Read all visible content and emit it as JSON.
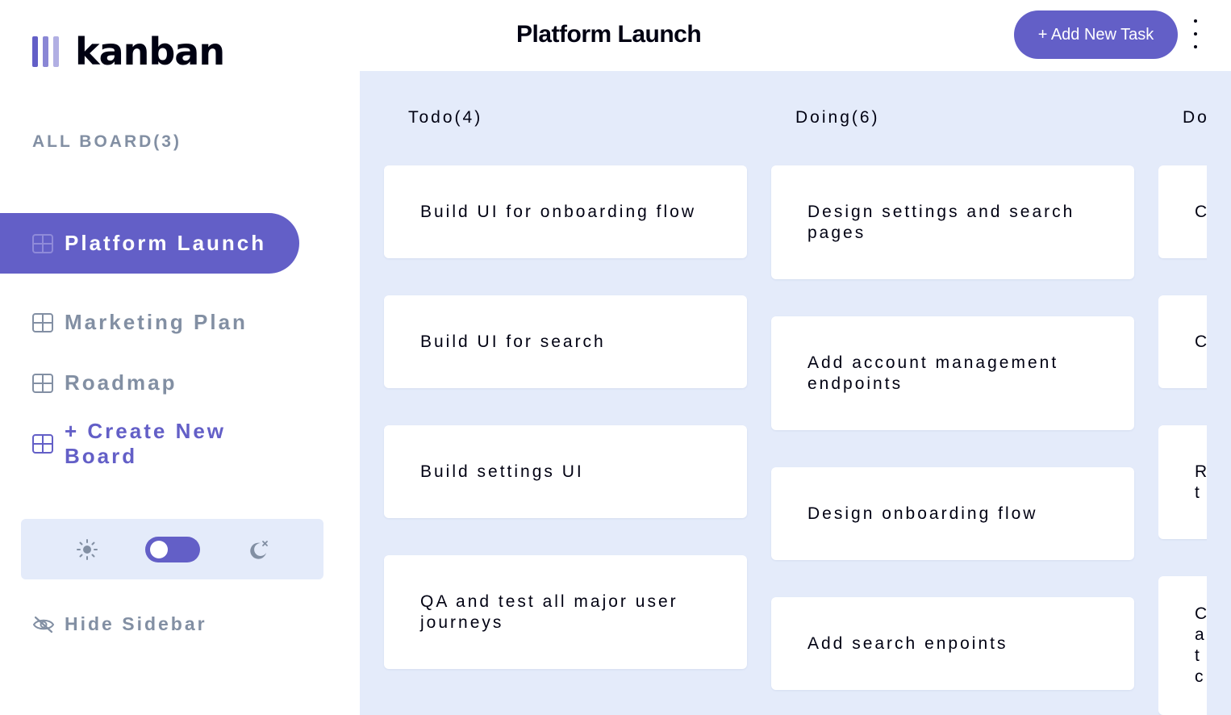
{
  "app": {
    "logo_text": "kanban"
  },
  "sidebar": {
    "board_count_label": "ALL BOARD(3)",
    "boards": [
      {
        "label": "Platform Launch",
        "active": true
      },
      {
        "label": "Marketing Plan",
        "active": false
      },
      {
        "label": "Roadmap",
        "active": false
      }
    ],
    "create_label": "+ Create New Board",
    "hide_label": "Hide Sidebar",
    "theme": {
      "light_icon": "sun-icon",
      "dark_icon": "moon-icon",
      "dark_mode": false
    }
  },
  "header": {
    "title": "Platform Launch",
    "add_task_label": "+ Add New Task"
  },
  "columns": [
    {
      "title": "Todo(4)",
      "tasks": [
        "Build UI for onboarding flow",
        "Build UI for search",
        "Build settings UI",
        "QA and test all major user journeys"
      ]
    },
    {
      "title": "Doing(6)",
      "tasks": [
        "Design settings and search pages",
        "Add account management endpoints",
        "Design onboarding flow",
        "Add search enpoints"
      ]
    },
    {
      "title": "Do",
      "tasks": [
        "C",
        "C",
        "R t",
        "C a t c"
      ]
    }
  ],
  "colors": {
    "accent": "#635fc7",
    "board_bg": "#e4ebfa",
    "muted_text": "#828fa3",
    "dark_text": "#000112"
  }
}
